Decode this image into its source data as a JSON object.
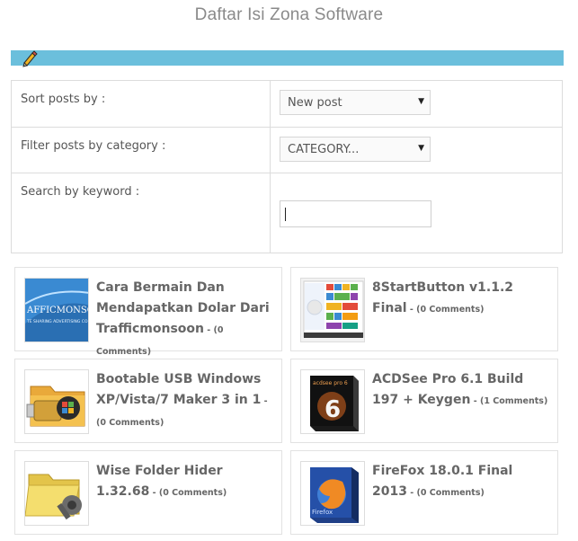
{
  "page": {
    "title": "Daftar Isi Zona Software"
  },
  "filters": {
    "sort": {
      "label": "Sort posts by :",
      "value": "New post"
    },
    "category": {
      "label": "Filter posts by category :",
      "value": "CATEGORY..."
    },
    "keyword": {
      "label": "Search by keyword :",
      "value": ""
    }
  },
  "posts": [
    {
      "title": "Cara Bermain Dan Mendapatkan Dolar Dari Trafficmonsoon",
      "sep": " - ",
      "comments": "(0 Comments)",
      "thumb_text": "AFFICMONSOO",
      "thumb_sub": "TE SHARING ADVERTISING CO"
    },
    {
      "title": "8StartButton v1.1.2 Final",
      "sep": " - ",
      "comments": "(0 Comments)"
    },
    {
      "title": "Bootable USB Windows XP/Vista/7 Maker 3 in 1",
      "sep": " - ",
      "comments": "(0 Comments)"
    },
    {
      "title": "ACDSee Pro 6.1 Build 197 + Keygen",
      "sep": " - ",
      "comments": "(1 Comments)",
      "thumb_text": "acdsee pro 6"
    },
    {
      "title": "Wise Folder Hider 1.32.68",
      "sep": " - ",
      "comments": "(0 Comments)"
    },
    {
      "title": "FireFox 18.0.1 Final 2013",
      "sep": " - ",
      "comments": "(0 Comments)",
      "thumb_text": "Firefox"
    }
  ],
  "colors": {
    "accent_bar": "#6bbfdc",
    "title_text": "#8a8a8a",
    "post_text": "#666666"
  }
}
